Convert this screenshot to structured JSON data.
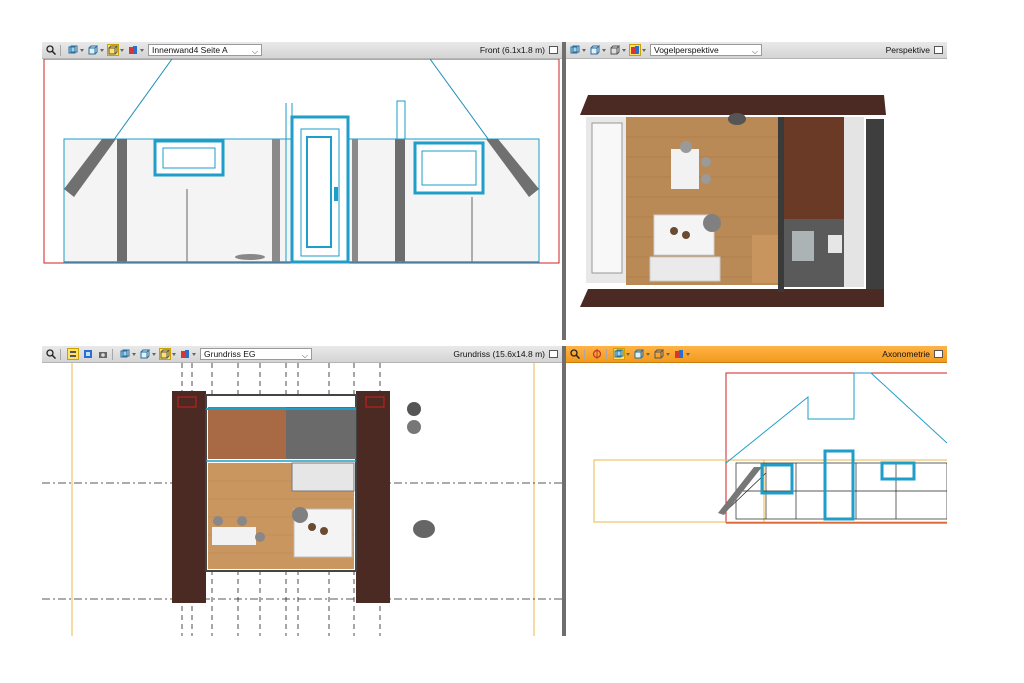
{
  "panes": {
    "front": {
      "view_select": "Innenwand4 Seite A",
      "view_title": "Front  (6.1x1.8 m)"
    },
    "perspective": {
      "view_select": "Vogelperspektive",
      "view_title": "Perspektive"
    },
    "plan": {
      "view_select": "Grundriss EG",
      "view_title": "Grundriss  (15.6x14.8 m)"
    },
    "axonometric": {
      "view_title": "Axonometrie"
    }
  },
  "icons": [
    "search-icon",
    "layers-icon",
    "cube-view-icon",
    "camera-icon",
    "material-icon",
    "shadow-icon",
    "maximize-icon"
  ],
  "colors": {
    "toolbar_active": "#f29a1c",
    "selection_blue": "#1e9ec8",
    "wall_red": "#d21f1f",
    "roof_brown": "#4a2a22",
    "wood_floor": "#b98a55",
    "axis_yellow": "#e8b84a"
  }
}
